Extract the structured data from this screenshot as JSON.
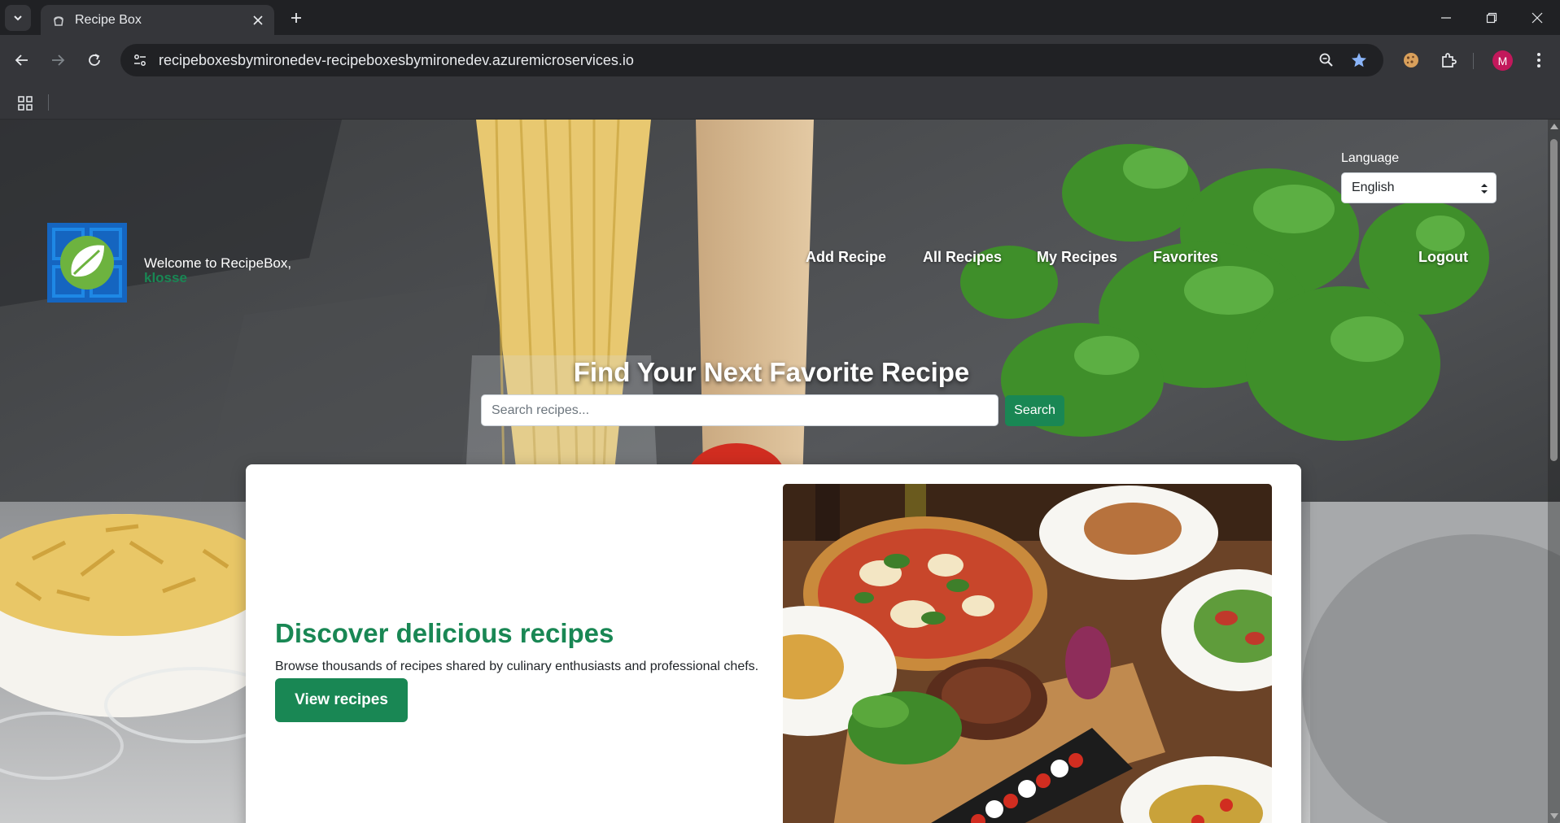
{
  "browser": {
    "tab_title": "Recipe Box",
    "url": "recipeboxesbymironedev-recipeboxesbymironedev.azuremicroservices.io",
    "profile_initial": "M",
    "icons": [
      "tab-search-icon",
      "recipe-favicon",
      "close-icon",
      "plus-icon",
      "minimize-icon",
      "restore-icon",
      "window-close-icon",
      "back-icon",
      "forward-icon",
      "reload-icon",
      "site-info-icon",
      "zoom-icon",
      "bookmark-star-icon",
      "cookie-extension-icon",
      "extensions-puzzle-icon",
      "kebab-menu-icon",
      "apps-grid-icon"
    ]
  },
  "page": {
    "language": {
      "label": "Language",
      "selected": "English"
    },
    "welcome": {
      "text": "Welcome to RecipeBox,",
      "username": "klosse"
    },
    "nav": {
      "add_recipe": "Add Recipe",
      "all_recipes": "All Recipes",
      "my_recipes": "My Recipes",
      "favorites": "Favorites",
      "logout": "Logout"
    },
    "hero": {
      "title": "Find Your Next Favorite Recipe",
      "search_placeholder": "Search recipes...",
      "search_button": "Search"
    },
    "feature": {
      "heading": "Discover delicious recipes",
      "text": "Browse thousands of recipes shared by culinary enthusiasts and professional chefs.",
      "button": "View recipes"
    }
  },
  "colors": {
    "brand_green": "#198754",
    "chrome_dark": "#202124",
    "chrome_toolbar": "#35363a",
    "logo_blue": "#1565c0",
    "logo_leaf_green": "#6db33f",
    "star_blue": "#8ab4f8"
  }
}
